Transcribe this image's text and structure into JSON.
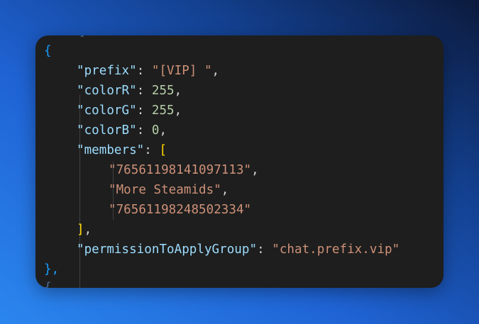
{
  "code": {
    "open_brace": "{",
    "close_brace": "},",
    "prefix_key": "\"prefix\"",
    "prefix_value": "\"[VIP] \"",
    "colorR_key": "\"colorR\"",
    "colorR_value": "255",
    "colorG_key": "\"colorG\"",
    "colorG_value": "255",
    "colorB_key": "\"colorB\"",
    "colorB_value": "0",
    "members_key": "\"members\"",
    "members_open": "[",
    "members_close": "]",
    "members": [
      "\"76561198141097113\"",
      "\"More Steamids\"",
      "\"76561198248502334\""
    ],
    "permission_key": "\"permissionToApplyGroup\"",
    "permission_value": "\"chat.prefix.vip\"",
    "colon": ": ",
    "comma": ","
  },
  "colors": {
    "key": "#9cdcfe",
    "string": "#ce9178",
    "number": "#b5cea8",
    "brace": "#179fff",
    "bracket": "#ffd700",
    "background": "#1e1e1e"
  }
}
